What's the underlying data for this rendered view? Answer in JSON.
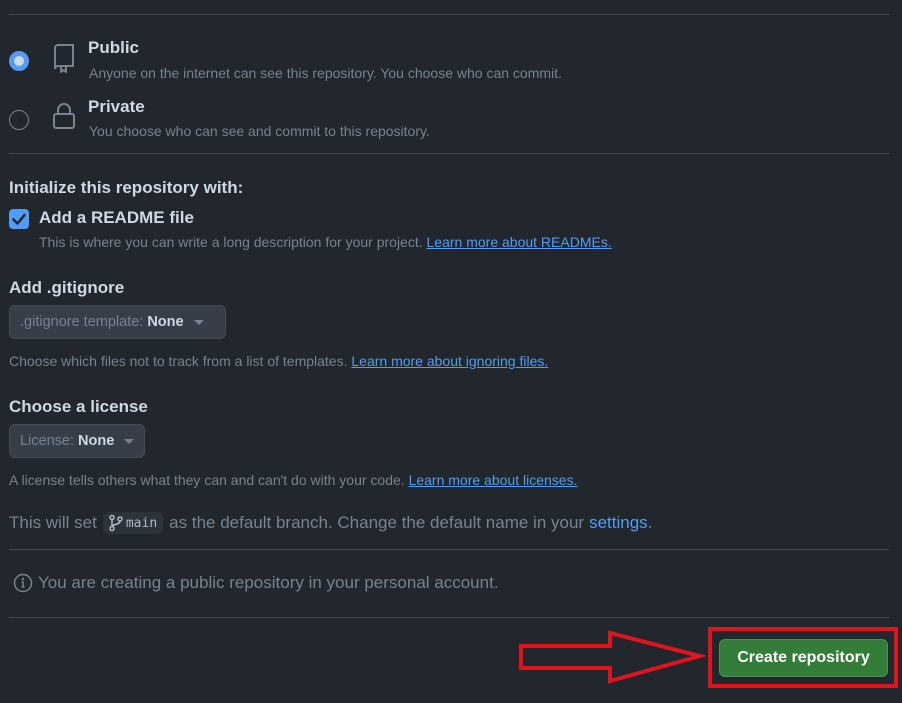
{
  "visibility": {
    "options": [
      {
        "title": "Public",
        "description": "Anyone on the internet can see this repository. You choose who can commit.",
        "selected": true,
        "icon": "repo-icon"
      },
      {
        "title": "Private",
        "description": "You choose who can see and commit to this repository.",
        "selected": false,
        "icon": "lock-icon"
      }
    ]
  },
  "initialize": {
    "heading": "Initialize this repository with:",
    "readme": {
      "label": "Add a README file",
      "checked": true,
      "description": "This is where you can write a long description for your project.",
      "link": "Learn more about READMEs."
    }
  },
  "gitignore": {
    "heading": "Add .gitignore",
    "select_prefix": ".gitignore template:",
    "select_value": "None",
    "description": "Choose which files not to track from a list of templates.",
    "link": "Learn more about ignoring files."
  },
  "license": {
    "heading": "Choose a license",
    "select_prefix": "License:",
    "select_value": "None",
    "description": "A license tells others what they can and can't do with your code.",
    "link": "Learn more about licenses."
  },
  "branch": {
    "prefix": "This will set",
    "name": "main",
    "middle": "as the default branch. Change the default name in your",
    "link": "settings",
    "suffix": "."
  },
  "info": {
    "text": "You are creating a public repository in your personal account."
  },
  "actions": {
    "create_label": "Create repository"
  },
  "colors": {
    "background": "#22272e",
    "accent": "#539bf5",
    "primary_button": "#347d39",
    "annotation": "#e0141e"
  }
}
